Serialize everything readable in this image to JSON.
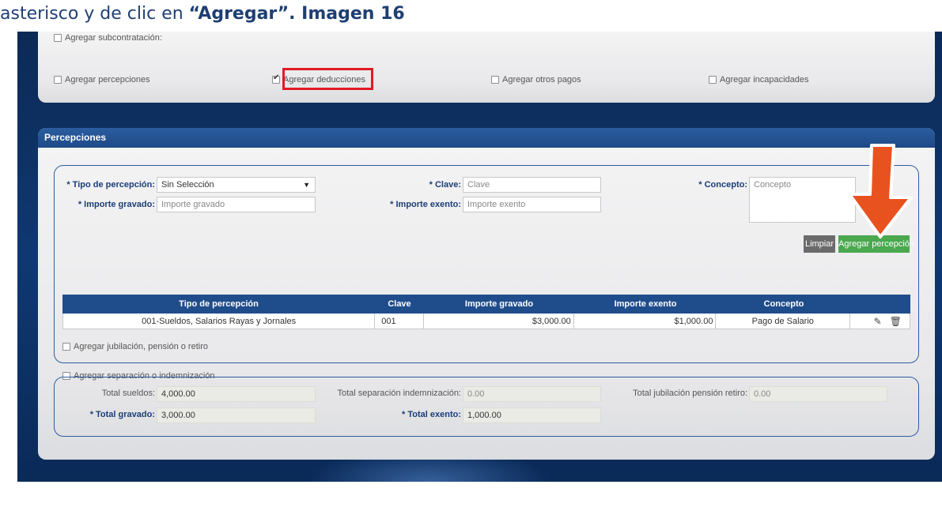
{
  "heading": {
    "prefix": "asterisco y de clic en ",
    "bold": "“Agregar”. Imagen 16"
  },
  "options": {
    "subcontratacion": "Agregar subcontratación:",
    "percepciones": "Agregar percepciones",
    "deducciones": "Agregar deducciones",
    "otros_pagos": "Agregar otros pagos",
    "incapacidades": "Agregar incapacidades"
  },
  "percepciones": {
    "title": "Percepciones",
    "tipo_label": "* Tipo de percepción:",
    "tipo_value": "Sin Selección",
    "clave_label": "* Clave:",
    "clave_placeholder": "Clave",
    "concepto_label": "* Concepto:",
    "concepto_placeholder": "Concepto",
    "gravado_label": "* Importe gravado:",
    "gravado_placeholder": "Importe gravado",
    "exento_label": "* Importe exento:",
    "exento_placeholder": "Importe exento",
    "limpiar": "Limpiar",
    "agregar": "Agregar percepción",
    "table": {
      "headers": [
        "Tipo de percepción",
        "Clave",
        "Importe gravado",
        "Importe exento",
        "Concepto",
        ""
      ],
      "rows": [
        [
          "001-Sueldos, Salarios Rayas y Jornales",
          "001",
          "$3,000.00",
          "$1,000.00",
          "Pago de Salario"
        ]
      ]
    },
    "jubilacion": "Agregar jubilación, pensión o retiro",
    "separacion": "Agregar separación o indemnización"
  },
  "totals": {
    "sueldos_label": "Total sueldos:",
    "sueldos_value": "4,000.00",
    "gravado_label": "* Total gravado:",
    "gravado_value": "3,000.00",
    "separacion_label": "Total separación indemnización:",
    "separacion_value": "0.00",
    "exento_label": "* Total exento:",
    "exento_value": "1,000.00",
    "jubilacion_label": "Total jubilación pensión retiro:",
    "jubilacion_value": "0.00"
  },
  "colors": {
    "accent_blue": "#1f4d8c",
    "highlight_red": "#e01b24",
    "button_green": "#4aa84f",
    "button_gray": "#6b6b6b",
    "arrow_orange": "#e8521f"
  },
  "icons": {
    "edit": "pencil-icon",
    "delete": "trash-icon",
    "dropdown": "caret-down-icon"
  }
}
